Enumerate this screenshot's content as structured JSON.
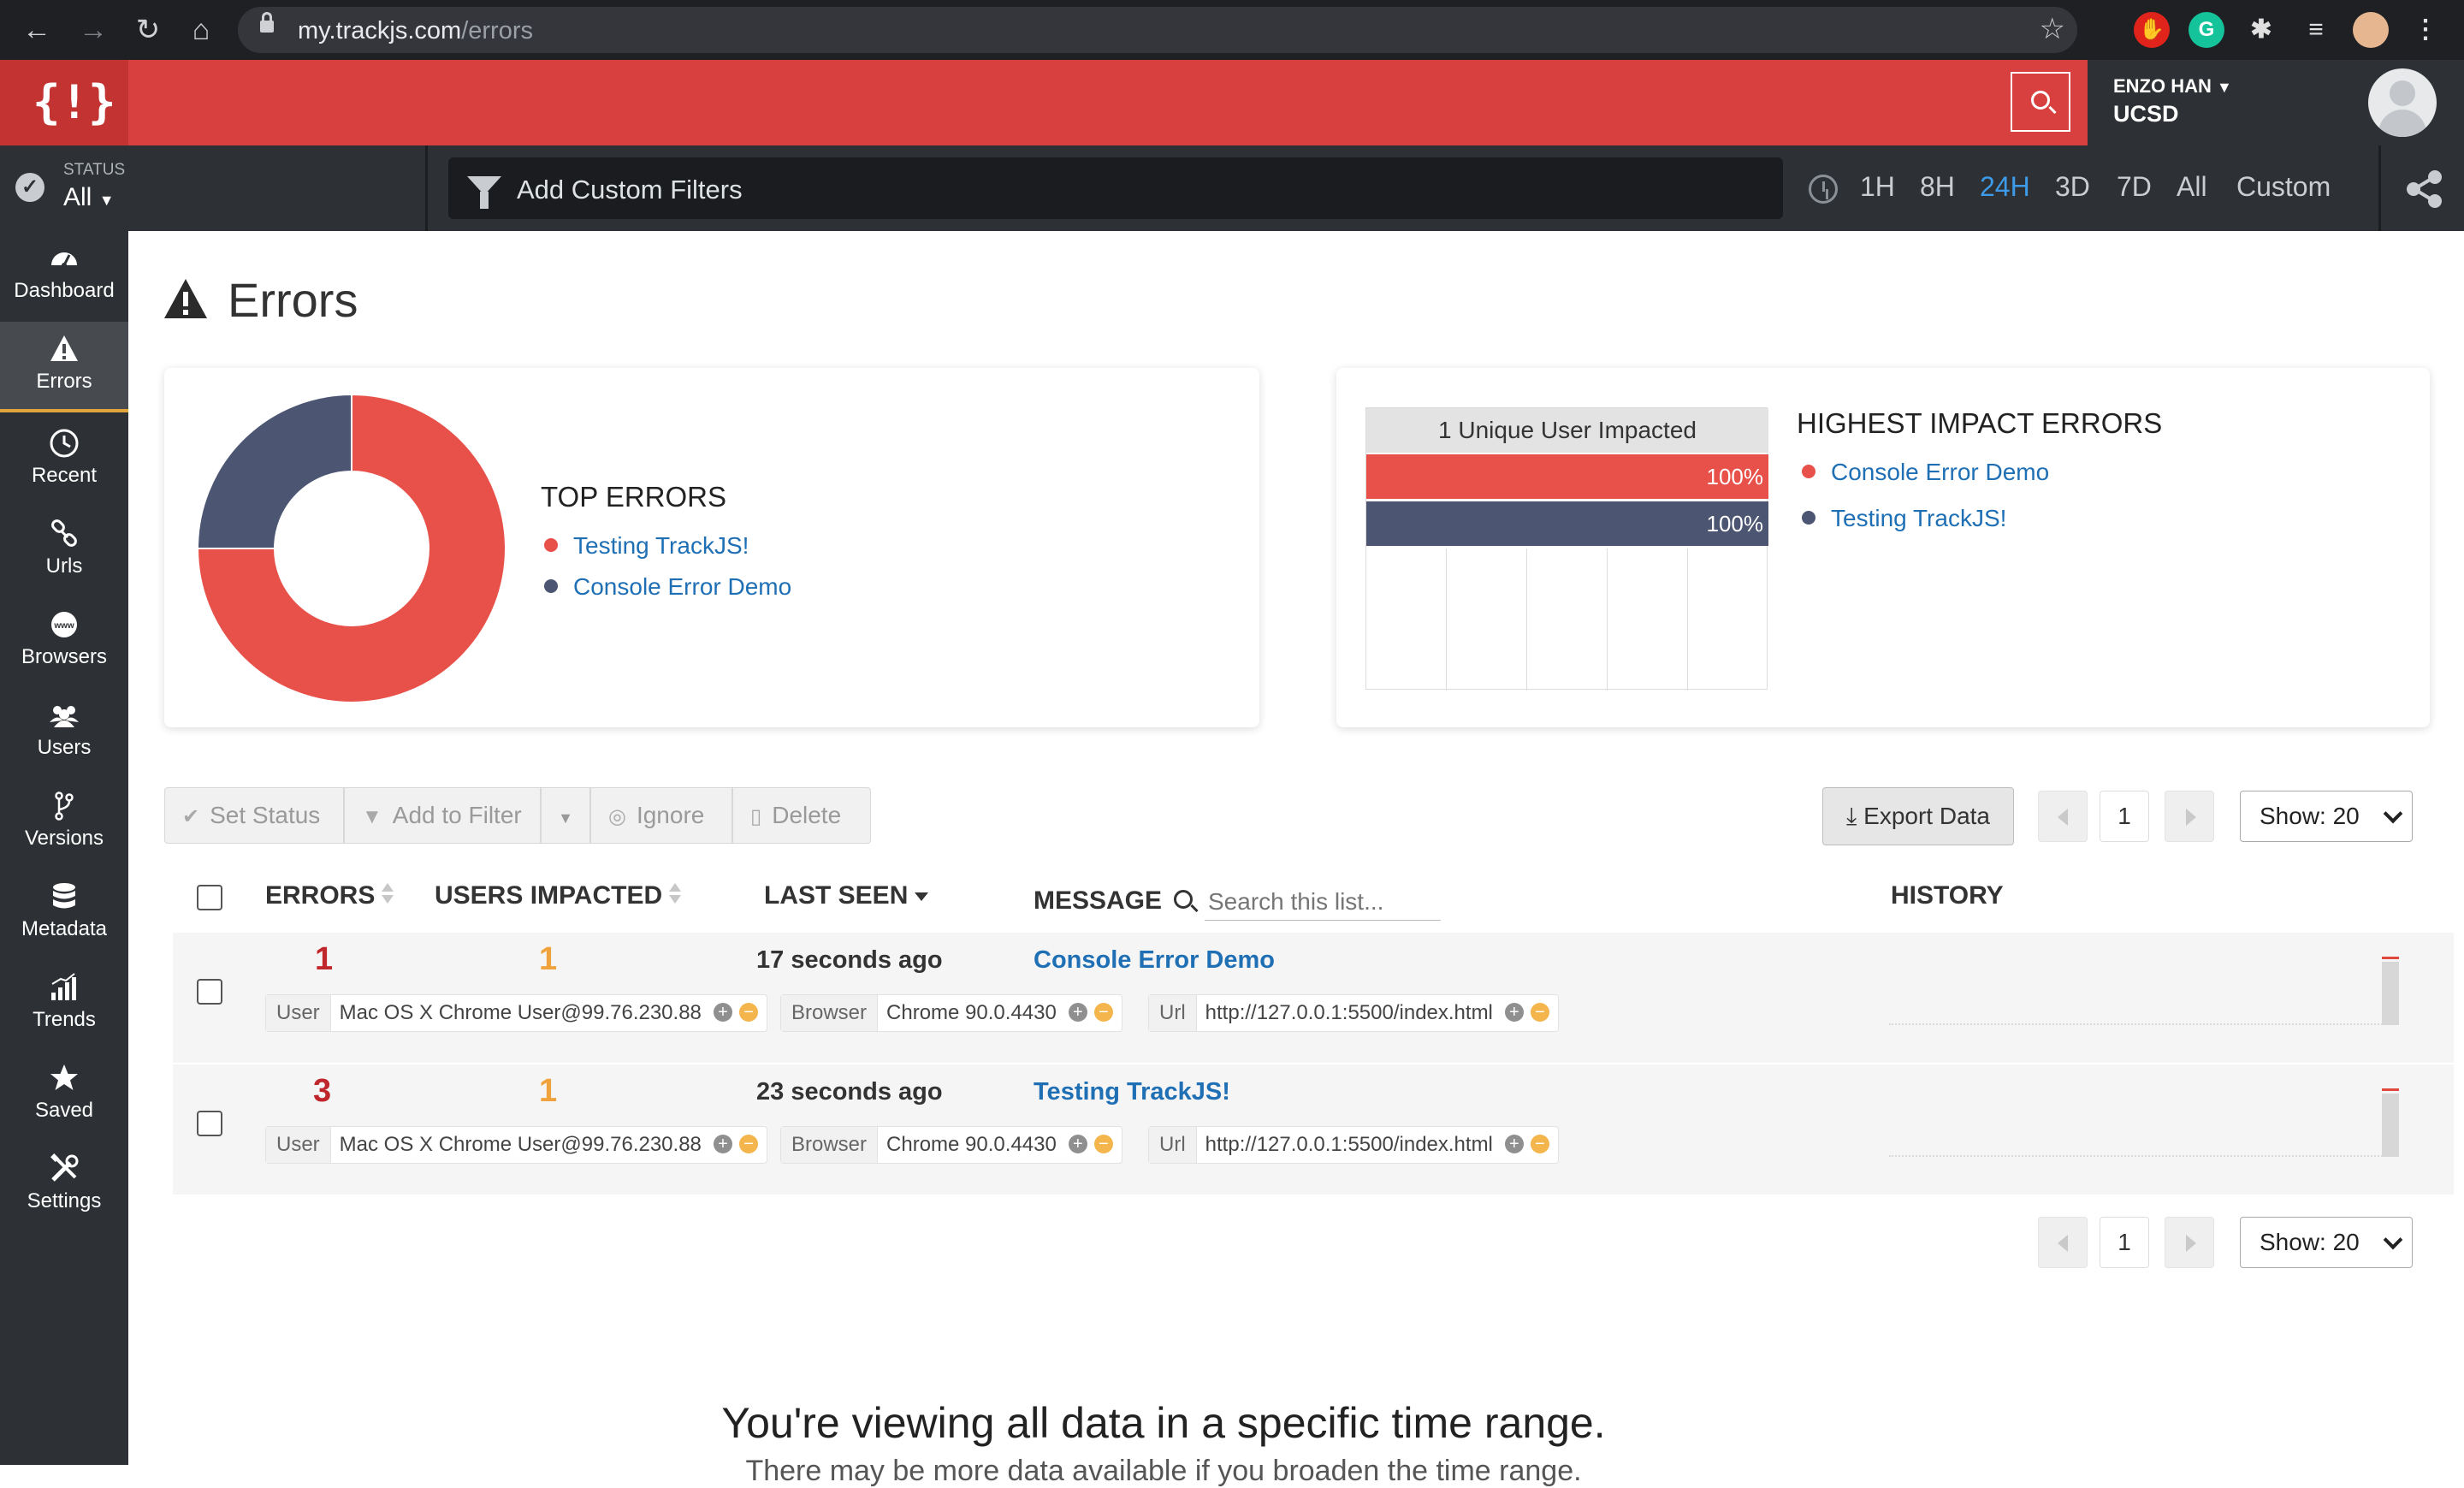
{
  "browser": {
    "url_host": "my.trackjs.com",
    "url_path": "/errors"
  },
  "header": {
    "user_name": "ENZO HAN",
    "user_org": "UCSD"
  },
  "filter_bar": {
    "status_label": "STATUS",
    "status_value": "All",
    "filters_placeholder": "Add Custom Filters",
    "time_options": [
      "1H",
      "8H",
      "24H",
      "3D",
      "7D",
      "All",
      "Custom"
    ],
    "time_active": "24H"
  },
  "sidebar": {
    "items": [
      {
        "label": "Dashboard",
        "icon": "dashboard-icon"
      },
      {
        "label": "Errors",
        "icon": "warning-icon",
        "active": true
      },
      {
        "label": "Recent",
        "icon": "clock-icon"
      },
      {
        "label": "Urls",
        "icon": "link-icon"
      },
      {
        "label": "Browsers",
        "icon": "www-globe-icon"
      },
      {
        "label": "Users",
        "icon": "users-icon"
      },
      {
        "label": "Versions",
        "icon": "branch-icon"
      },
      {
        "label": "Metadata",
        "icon": "database-icon"
      },
      {
        "label": "Trends",
        "icon": "bar-chart-icon"
      },
      {
        "label": "Saved",
        "icon": "star-icon"
      },
      {
        "label": "Settings",
        "icon": "tools-icon"
      }
    ]
  },
  "page": {
    "title": "Errors"
  },
  "top_errors": {
    "title": "TOP ERRORS",
    "legend": [
      {
        "label": "Testing TrackJS!",
        "color": "#e8514a"
      },
      {
        "label": "Console Error Demo",
        "color": "#4c5673"
      }
    ]
  },
  "impact": {
    "header": "1 Unique User Impacted",
    "title": "HIGHEST IMPACT ERRORS",
    "bars": [
      {
        "label": "100%",
        "color": "#e8514a"
      },
      {
        "label": "100%",
        "color": "#4c5673"
      }
    ],
    "legend": [
      {
        "label": "Console Error Demo",
        "color": "#e8514a"
      },
      {
        "label": "Testing TrackJS!",
        "color": "#4c5673"
      }
    ]
  },
  "chart_data": [
    {
      "type": "pie",
      "title": "TOP ERRORS",
      "categories": [
        "Testing TrackJS!",
        "Console Error Demo"
      ],
      "values": [
        3,
        1
      ],
      "colors": [
        "#e8514a",
        "#4c5673"
      ]
    },
    {
      "type": "bar",
      "title": "HIGHEST IMPACT ERRORS",
      "categories": [
        "Console Error Demo",
        "Testing TrackJS!"
      ],
      "values": [
        100,
        100
      ],
      "ylabel": "1 Unique User Impacted",
      "colors": [
        "#e8514a",
        "#4c5673"
      ]
    }
  ],
  "toolbar": {
    "set_status": "Set Status",
    "add_to_filter": "Add to Filter",
    "ignore": "Ignore",
    "delete": "Delete",
    "export": "Export Data",
    "page": "1",
    "show": "Show: 20"
  },
  "table": {
    "headers": {
      "errors": "ERRORS",
      "users": "USERS IMPACTED",
      "last_seen": "LAST SEEN",
      "message": "MESSAGE",
      "history": "HISTORY"
    },
    "search_placeholder": "Search this list...",
    "rows": [
      {
        "errors": "1",
        "users": "1",
        "last_seen": "17 seconds ago",
        "message": "Console Error Demo",
        "user_key": "User",
        "user_val": "Mac OS X Chrome User@99.76.230.88",
        "browser_key": "Browser",
        "browser_val": "Chrome 90.0.4430",
        "url_key": "Url",
        "url_val": "http://127.0.0.1:5500/index.html"
      },
      {
        "errors": "3",
        "users": "1",
        "last_seen": "23 seconds ago",
        "message": "Testing TrackJS!",
        "user_key": "User",
        "user_val": "Mac OS X Chrome User@99.76.230.88",
        "browser_key": "Browser",
        "browser_val": "Chrome 90.0.4430",
        "url_key": "Url",
        "url_val": "http://127.0.0.1:5500/index.html"
      }
    ]
  },
  "footer": {
    "message": "You're viewing all data in a specific time range.",
    "sub": "There may be more data available if you broaden the time range."
  }
}
